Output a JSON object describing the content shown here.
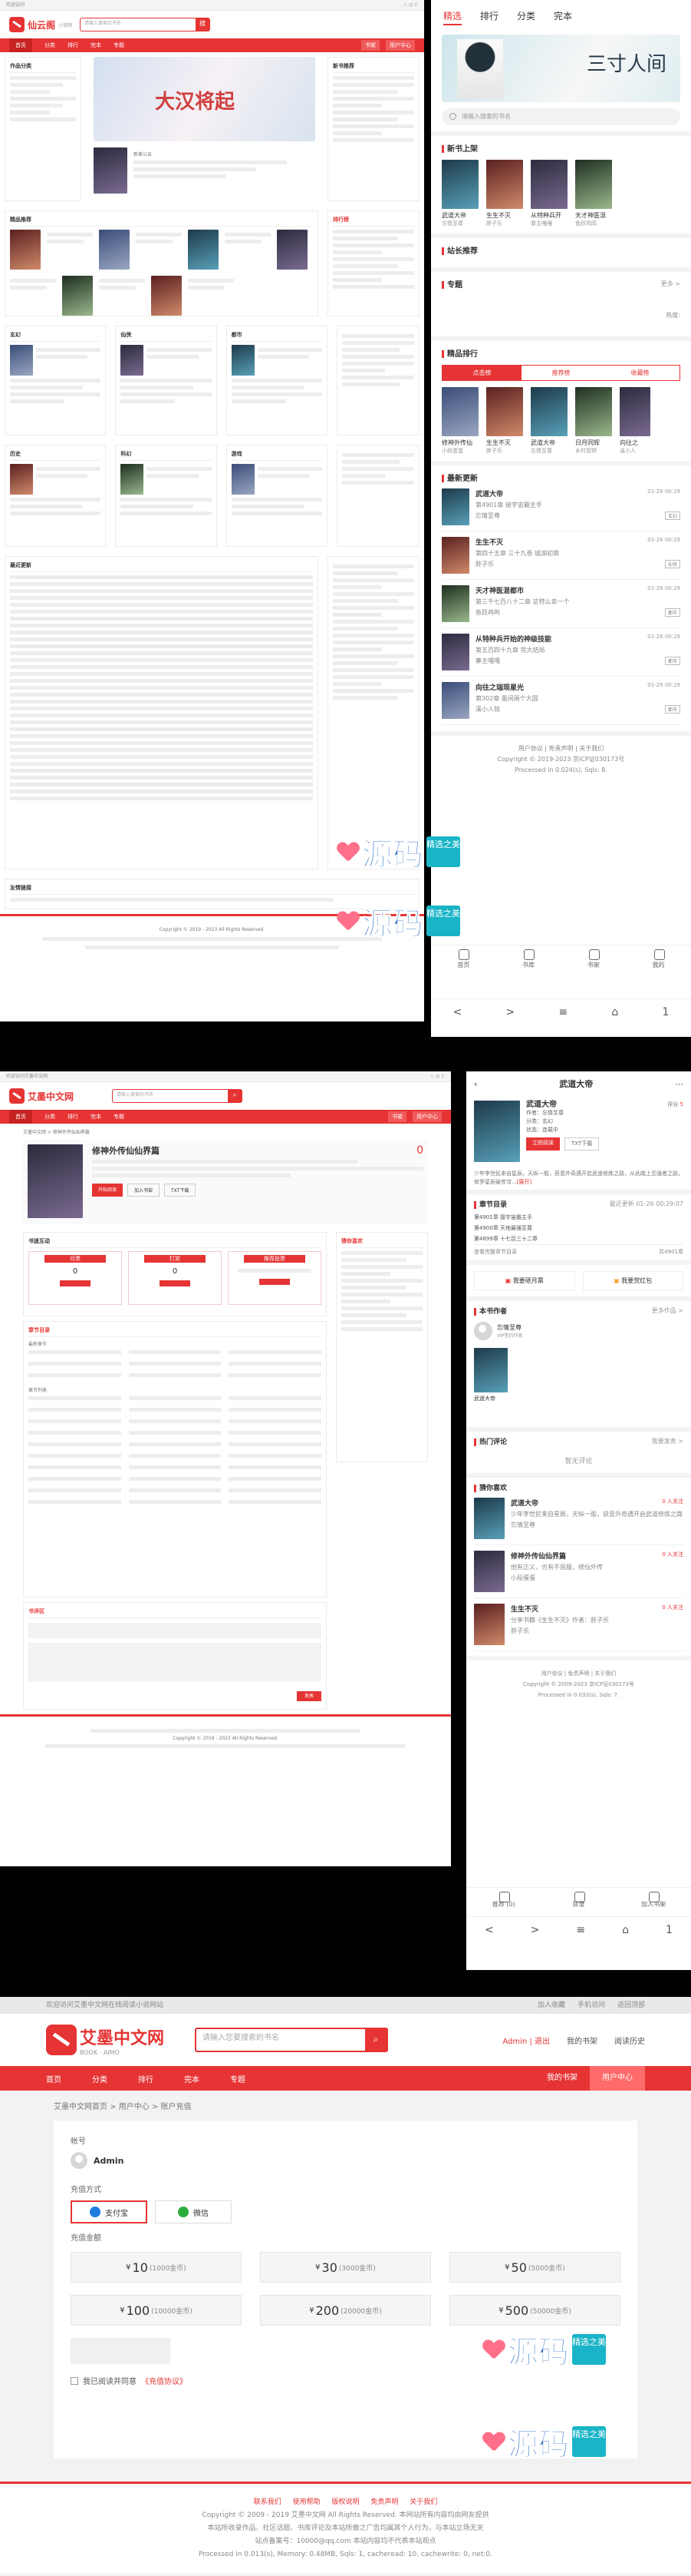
{
  "desktop_home": {
    "topbar_left": "欢迎访问",
    "logo_text": "仙云阁",
    "logo_sub": "小说网",
    "search_placeholder": "请输入搜索的书名",
    "search_btn": "搜",
    "nav": [
      "首页",
      "分类",
      "排行",
      "完本",
      "专题"
    ],
    "nav_right": [
      "书架",
      "用户中心"
    ],
    "sec_works": "作品分类",
    "sec_new": "新书推荐",
    "sec_hot": "精品推荐",
    "sec_rank": "排行榜",
    "sec_recent": "最近更新",
    "sec_links": "友情链接",
    "banner_title": "大汉将起",
    "hero_book": "新章公告",
    "cat_titles": [
      "玄幻",
      "仙侠",
      "都市",
      "历史",
      "科幻",
      "游戏",
      "同人"
    ],
    "copyright": "Copyright © 2019 - 2023 All Rights Reserved."
  },
  "mobile_home": {
    "tabs": [
      "精选",
      "排行",
      "分类",
      "完本"
    ],
    "banner_calli": "三寸人间",
    "search_placeholder": "请输入搜索的书名",
    "sec_new_shelf": "新书上架",
    "new_books": [
      {
        "title": "武道大帝",
        "author": "忘情至尊"
      },
      {
        "title": "生生不灭",
        "author": "胖子乐"
      },
      {
        "title": "从特种兵开",
        "author": "寨主嘎嘎"
      },
      {
        "title": "天才神医混",
        "author": "鱼跃鸡鸣"
      }
    ],
    "sec_webmaster": "站长推荐",
    "sec_topic": "专题",
    "topic_more": "更多 >",
    "topic_hot": "热度:",
    "sec_rank": "精品排行",
    "rank_tabs": [
      "点击榜",
      "推荐榜",
      "收藏榜"
    ],
    "rank_books": [
      {
        "title": "修神外传仙",
        "author": "小段蛋蛋"
      },
      {
        "title": "生生不灭",
        "author": "胖子乐"
      },
      {
        "title": "武道大帝",
        "author": "忘情至尊"
      },
      {
        "title": "日月同辉",
        "author": "乡村冒野"
      },
      {
        "title": "向往之",
        "author": "溪小人"
      }
    ],
    "sec_latest": "最新更新",
    "latest": [
      {
        "title": "武道大帝",
        "time": "01-26 00:29",
        "chapter": "第4901章 接宇宙霸主手",
        "author": "忘情至尊",
        "tag": "玄幻"
      },
      {
        "title": "生生不灭",
        "time": "01-26 00:29",
        "chapter": "第四十五章 三十九卷 城湖初鼎",
        "author": "胖子乐",
        "tag": "仙侠"
      },
      {
        "title": "天才神医混都市",
        "time": "01-26 00:29",
        "chapter": "第三千七百八十二章 这特么卖一个",
        "author": "鱼跃鸡鸣",
        "tag": "都市"
      },
      {
        "title": "从特种兵开始的神级技能",
        "time": "01-26 00:29",
        "chapter": "第五百四十九章 完大结局",
        "author": "寨主嘎嘎",
        "tag": "都市"
      },
      {
        "title": "向往之瑞现星光",
        "time": "01-26 00:29",
        "chapter": "第302章 墨闲画个大圆",
        "author": "溪小人铭",
        "tag": "都市"
      }
    ],
    "footer_links": "用户协议 | 免责声明 | 关于我们",
    "footer_copy": "Copyright © 2019-2023 京ICP证030173号",
    "footer_proc": "Processed in 0.024(s), Sqls: 8.",
    "tabbar": [
      "首页",
      "书库",
      "书架",
      "我的"
    ],
    "sys": [
      "<",
      ">",
      "≡",
      "⌂",
      "1"
    ]
  },
  "desktop_detail": {
    "topbar": "欢迎访问艾墨中文网",
    "logo_text": "艾墨中文网",
    "search_placeholder": "请输入搜索的书名",
    "nav": [
      "首页",
      "分类",
      "排行",
      "完本",
      "专题"
    ],
    "nav_right": [
      "书架",
      "用户中心"
    ],
    "crumb": "艾墨中文网 > 修神外传仙仙界篇",
    "book_title": "修神外传仙仙界篇",
    "score": "0",
    "btn_read": "开始阅读",
    "btn_shelf": "加入书架",
    "btn_txt": "TXT下载",
    "sec_interact": "书迷互动",
    "vote_left": "月票",
    "vote_mid": "打赏",
    "vote_right": "推荐投票",
    "vote_count": "0",
    "sec_catalog": "章节目录",
    "sec_latest_ch": "最新章节",
    "sec_list": "章节列表",
    "sec_comment": "书评区",
    "btn_comment": "发表",
    "side_rank": "猜你喜欢",
    "footer_copy": "Copyright © 2019 - 2023 All Rights Reserved."
  },
  "mobile_detail": {
    "title": "武道大帝",
    "book_name": "武道大帝",
    "author": "作者：忘情至尊",
    "category": "分类：玄幻",
    "status": "状态：连载中",
    "score_label": "评分",
    "score": "5",
    "btn_read": "立即阅读",
    "btn_txt": "TXT下载",
    "intro": "少年李世民来自星辰，天纵一般，获意外奇遇开启武道修炼之路，从此踏上至强者之路，修罗星辰破苍穹...",
    "intro_more": "[展开]",
    "sec_catalog": "章节目录",
    "latest_label": "最近更新",
    "latest_time": "01-26 00:29:07",
    "ch1": "第4901章 接宇宙霸主手",
    "ch2": "第4900章 天地最强至尊",
    "ch3": "第4899章 十七百三十二章",
    "view_all": "查看完整章节目录",
    "ch_count": "共4901章",
    "btn_monthly": "我要砸月票",
    "btn_gift": "我要赏红包",
    "sec_author": "本书作者",
    "author_more": "更多作品 >",
    "author_name": "忘情至尊",
    "author_tag": "VIP签约作家",
    "author_book": "武道大帝",
    "sec_hot_comment": "热门评论",
    "hot_more": "我要发表 >",
    "no_comment": "暂无评论",
    "sec_guess": "猜你喜欢",
    "guess": [
      {
        "title": "武道大帝",
        "tag": "0 人关注",
        "desc": "少年李世民来自星辰，天纵一般，获意外奇遇开启武道修炼之路",
        "author": "忘情至尊"
      },
      {
        "title": "修神外传仙仙界篇",
        "tag": "0 人关注",
        "desc": "他有正义，也有不屈服，修仙外传",
        "author": "小段蛋蛋"
      },
      {
        "title": "生生不灭",
        "tag": "0 人关注",
        "desc": "分享书籍《生生不灭》作者：胖子乐",
        "author": "胖子乐"
      }
    ],
    "footer_links": "用户协议 | 免责声明 | 关于我们",
    "footer_copy": "Copyright © 2009-2023 京ICP证030173号",
    "footer_proc": "Processed in 0.032(s), Sqls: 7.",
    "tabbar": [
      "推荐 (0)",
      "目录",
      "加入书架"
    ],
    "sys": [
      "<",
      ">",
      "≡",
      "⌂",
      "1"
    ]
  },
  "account": {
    "topbar_left": "欢迎访问艾墨中文网在线阅读小说网站",
    "topbar_right": [
      "加入收藏",
      "手机访问",
      "返回顶部"
    ],
    "logo_text": "艾墨中文网",
    "logo_sub": "BOOK · AIMO",
    "search_placeholder": "请输入您要搜索的书名",
    "search_btn": "⌕",
    "user_admin": "Admin | 退出",
    "user_links": [
      "我的书架",
      "阅读历史"
    ],
    "nav": [
      "首页",
      "分类",
      "排行",
      "完本",
      "专题"
    ],
    "nav_right": [
      "我的书架",
      "用户中心"
    ],
    "crumb": "艾墨中文网首页 > 用户中心 > 账户充值",
    "label_account": "帐号",
    "username": "Admin",
    "label_pay": "充值方式",
    "pay_methods": [
      "支付宝",
      "微信"
    ],
    "label_amount": "充值金额",
    "amounts": [
      {
        "value": "10",
        "gold": "(1000金币)"
      },
      {
        "value": "30",
        "gold": "(3000金币)"
      },
      {
        "value": "50",
        "gold": "(5000金币)"
      },
      {
        "value": "100",
        "gold": "(10000金币)"
      },
      {
        "value": "200",
        "gold": "(20000金币)"
      },
      {
        "value": "500",
        "gold": "(50000金币)"
      }
    ],
    "currency": "¥",
    "agree_text": "我已阅读并同意",
    "agree_link": "《充值协议》",
    "footer_links": [
      "联系我们",
      "使用帮助",
      "版权说明",
      "免责声明",
      "关于我们"
    ],
    "footer_copy": "Copyright © 2009 - 2019 艾墨中文网 All Rights Reserved. 本网站所有内容均由网友提供",
    "footer_l2": "本站所收录作品、社区话题、书库评论及本站所做之广告均属其个人行为，与本站立场无关",
    "footer_l3": "站点备案号：10000@qq.com 本站内容均不代表本站观点",
    "footer_l4": "Processed in 0.013(s), Memory: 0.48MB, Sqls: 1, cacheread: 10, cachewrite: 0, net:0."
  },
  "watermark": {
    "text": "源码",
    "seal": "精选之美"
  }
}
